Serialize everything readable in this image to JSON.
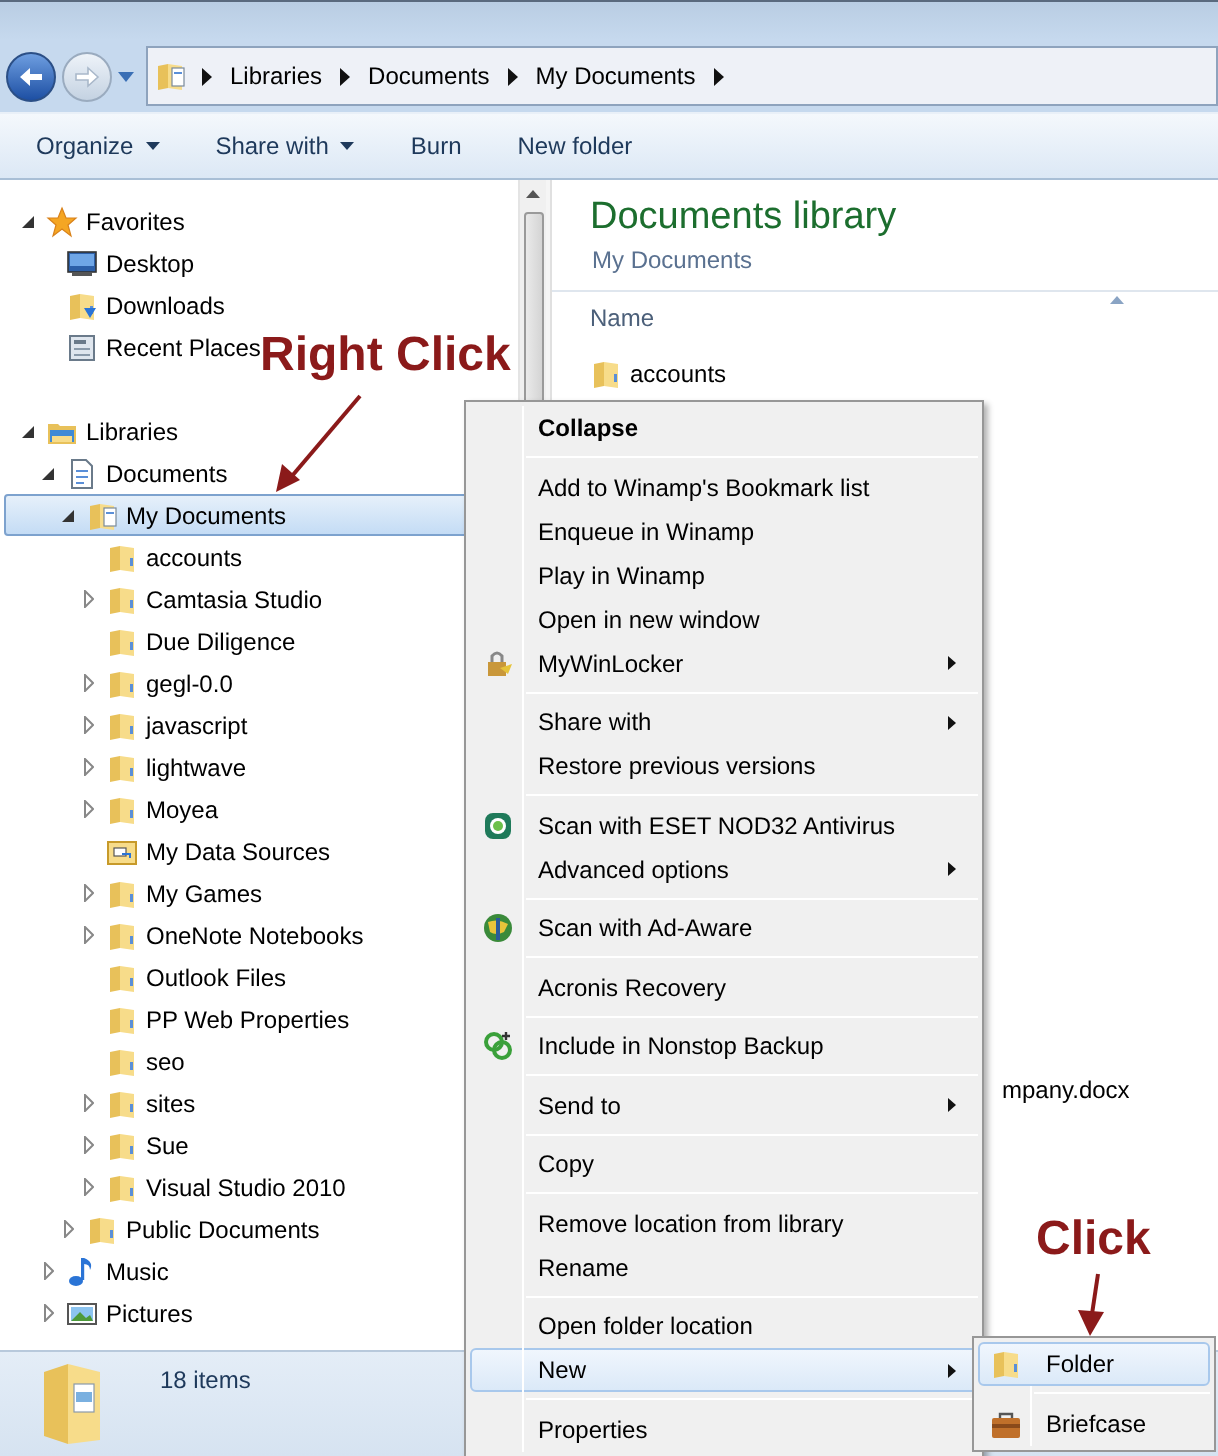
{
  "nav": {
    "breadcrumb": [
      "Libraries",
      "Documents",
      "My Documents"
    ]
  },
  "toolbar": [
    {
      "label": "Organize",
      "dropdown": true
    },
    {
      "label": "Share with",
      "dropdown": true
    },
    {
      "label": "Burn",
      "dropdown": false
    },
    {
      "label": "New folder",
      "dropdown": false
    }
  ],
  "tree": [
    {
      "label": "Favorites",
      "expandable": true,
      "expanded": true,
      "selected": false,
      "children": [
        {
          "label": "Desktop",
          "expandable": false,
          "selected": false
        },
        {
          "label": "Downloads",
          "expandable": false,
          "selected": false
        },
        {
          "label": "Recent Places",
          "expandable": false,
          "selected": false
        }
      ]
    },
    {
      "label": "Libraries",
      "expandable": true,
      "expanded": true,
      "selected": false,
      "children": [
        {
          "label": "Documents",
          "expandable": true,
          "expanded": true,
          "selected": false,
          "children": [
            {
              "label": "My Documents",
              "expandable": true,
              "expanded": true,
              "selected": true,
              "children": [
                {
                  "label": "accounts",
                  "expandable": false,
                  "selected": false
                },
                {
                  "label": "Camtasia Studio",
                  "expandable": true,
                  "expanded": false,
                  "selected": false
                },
                {
                  "label": "Due Diligence",
                  "expandable": false,
                  "selected": false
                },
                {
                  "label": "gegl-0.0",
                  "expandable": true,
                  "expanded": false,
                  "selected": false
                },
                {
                  "label": "javascript",
                  "expandable": true,
                  "expanded": false,
                  "selected": false
                },
                {
                  "label": "lightwave",
                  "expandable": true,
                  "expanded": false,
                  "selected": false
                },
                {
                  "label": "Moyea",
                  "expandable": true,
                  "expanded": false,
                  "selected": false
                },
                {
                  "label": "My Data Sources",
                  "expandable": false,
                  "selected": false
                },
                {
                  "label": "My Games",
                  "expandable": true,
                  "expanded": false,
                  "selected": false
                },
                {
                  "label": "OneNote Notebooks",
                  "expandable": true,
                  "expanded": false,
                  "selected": false
                },
                {
                  "label": "Outlook Files",
                  "expandable": false,
                  "selected": false
                },
                {
                  "label": "PP Web Properties",
                  "expandable": false,
                  "selected": false
                },
                {
                  "label": "seo",
                  "expandable": false,
                  "selected": false
                },
                {
                  "label": "sites",
                  "expandable": true,
                  "expanded": false,
                  "selected": false
                },
                {
                  "label": "Sue",
                  "expandable": true,
                  "expanded": false,
                  "selected": false
                },
                {
                  "label": "Visual Studio 2010",
                  "expandable": true,
                  "expanded": false,
                  "selected": false
                }
              ]
            },
            {
              "label": "Public Documents",
              "expandable": true,
              "expanded": false,
              "selected": false
            }
          ]
        },
        {
          "label": "Music",
          "expandable": true,
          "expanded": false,
          "selected": false
        },
        {
          "label": "Pictures",
          "expandable": true,
          "expanded": false,
          "selected": false
        }
      ]
    }
  ],
  "content": {
    "title": "Documents library",
    "subtitle": "My Documents",
    "columns": [
      "Name"
    ],
    "files": [
      {
        "name": "accounts",
        "kind": "folder"
      },
      {
        "name": "mpany.docx",
        "kind": "document"
      }
    ]
  },
  "status_bar": {
    "text": "18 items"
  },
  "context_menu": [
    {
      "kind": "item",
      "label": "Collapse",
      "default": true,
      "submenu": false,
      "selected": false
    },
    {
      "kind": "separator"
    },
    {
      "kind": "item",
      "label": "Add to Winamp's Bookmark list",
      "default": false,
      "submenu": false,
      "selected": false
    },
    {
      "kind": "item",
      "label": "Enqueue in Winamp",
      "default": false,
      "submenu": false,
      "selected": false
    },
    {
      "kind": "item",
      "label": "Play in Winamp",
      "default": false,
      "submenu": false,
      "selected": false
    },
    {
      "kind": "item",
      "label": "Open in new window",
      "default": false,
      "submenu": false,
      "selected": false
    },
    {
      "kind": "item",
      "label": "MyWinLocker",
      "default": false,
      "submenu": true,
      "selected": false
    },
    {
      "kind": "separator"
    },
    {
      "kind": "item",
      "label": "Share with",
      "default": false,
      "submenu": true,
      "selected": false
    },
    {
      "kind": "item",
      "label": "Restore previous versions",
      "default": false,
      "submenu": false,
      "selected": false
    },
    {
      "kind": "separator"
    },
    {
      "kind": "item",
      "label": "Scan with ESET NOD32 Antivirus",
      "default": false,
      "submenu": false,
      "selected": false
    },
    {
      "kind": "item",
      "label": "Advanced options",
      "default": false,
      "submenu": true,
      "selected": false
    },
    {
      "kind": "separator"
    },
    {
      "kind": "item",
      "label": "Scan with Ad-Aware",
      "default": false,
      "submenu": false,
      "selected": false
    },
    {
      "kind": "separator"
    },
    {
      "kind": "item",
      "label": "Acronis Recovery",
      "default": false,
      "submenu": false,
      "selected": false
    },
    {
      "kind": "separator"
    },
    {
      "kind": "item",
      "label": "Include in Nonstop Backup",
      "default": false,
      "submenu": false,
      "selected": false
    },
    {
      "kind": "separator"
    },
    {
      "kind": "item",
      "label": "Send to",
      "default": false,
      "submenu": true,
      "selected": false
    },
    {
      "kind": "separator"
    },
    {
      "kind": "item",
      "label": "Copy",
      "default": false,
      "submenu": false,
      "selected": false
    },
    {
      "kind": "separator"
    },
    {
      "kind": "item",
      "label": "Remove location from library",
      "default": false,
      "submenu": false,
      "selected": false
    },
    {
      "kind": "item",
      "label": "Rename",
      "default": false,
      "submenu": false,
      "selected": false
    },
    {
      "kind": "separator"
    },
    {
      "kind": "item",
      "label": "Open folder location",
      "default": false,
      "submenu": false,
      "selected": false
    },
    {
      "kind": "item",
      "label": "New",
      "default": false,
      "submenu": true,
      "selected": true
    },
    {
      "kind": "separator"
    },
    {
      "kind": "item",
      "label": "Properties",
      "default": false,
      "submenu": false,
      "selected": false
    }
  ],
  "submenu": [
    {
      "label": "Folder",
      "selected": true
    },
    {
      "label": "Briefcase",
      "selected": false
    }
  ],
  "annotations": [
    {
      "text": "Right Click"
    },
    {
      "text": "Click"
    }
  ]
}
